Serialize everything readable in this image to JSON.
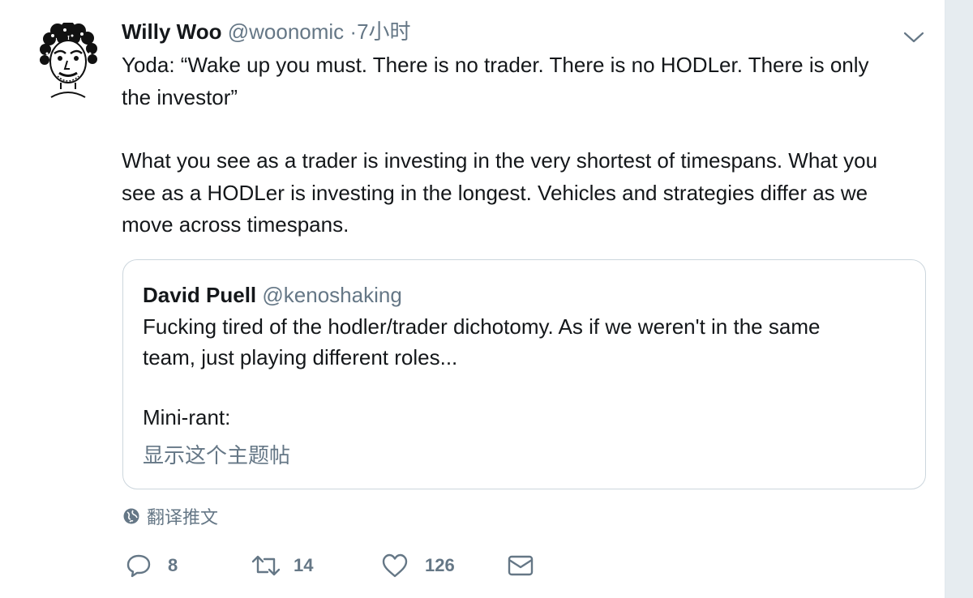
{
  "tweet": {
    "author_name": "Willy Woo",
    "author_handle": "@woonomic",
    "separator": "·",
    "time": "7小时",
    "lines": [
      "Yoda: “Wake up you must. There is no trader. There is no HODLer. There is only",
      "the investor”",
      "What you see as a trader is investing in the very shortest of timespans. What you",
      "see as a HODLer is investing in the longest. Vehicles and strategies differ as we",
      "move across timespans."
    ]
  },
  "quote": {
    "author_name": "David Puell",
    "author_handle": "@kenoshaking",
    "lines": [
      "Fucking tired of the hodler/trader dichotomy. As if we weren't in the same",
      "team, just playing different roles...",
      "Mini-rant:"
    ],
    "show_thread": "显示这个主题帖"
  },
  "translate_label": "翻译推文",
  "actions": {
    "reply_count": "8",
    "retweet_count": "14",
    "like_count": "126"
  },
  "icons": {
    "avatar": "avatar-illustration",
    "menu": "chevron-down-icon",
    "translate": "globe-icon",
    "reply": "reply-icon",
    "retweet": "retweet-icon",
    "like": "heart-icon",
    "dm": "envelope-icon"
  },
  "colors": {
    "text": "#14171a",
    "secondary": "#657786",
    "border": "#ccd6dd",
    "background": "#e6ecf0"
  }
}
